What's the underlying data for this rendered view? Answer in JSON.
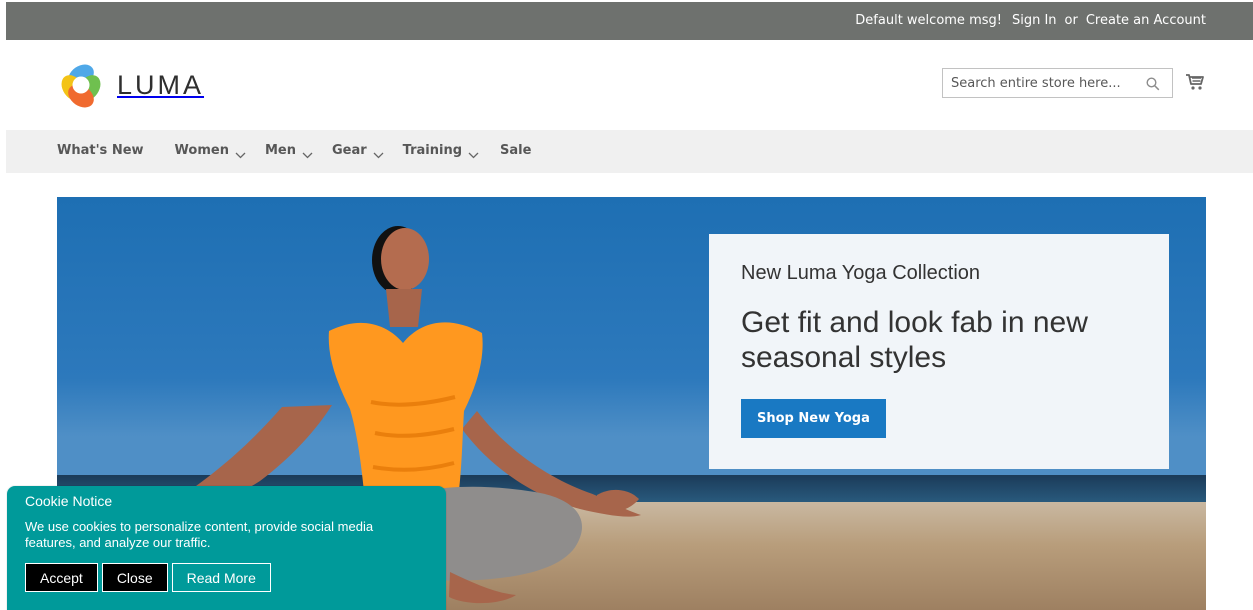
{
  "top_bar": {
    "welcome": "Default welcome msg!",
    "sign_in": "Sign In",
    "separator": "or",
    "create_account": "Create an Account"
  },
  "header": {
    "brand": "LUMA",
    "search_placeholder": "Search entire store here...",
    "search_value": ""
  },
  "nav": {
    "items": [
      {
        "label": "What's New",
        "has_dropdown": false
      },
      {
        "label": "Women",
        "has_dropdown": true
      },
      {
        "label": "Men",
        "has_dropdown": true
      },
      {
        "label": "Gear",
        "has_dropdown": true
      },
      {
        "label": "Training",
        "has_dropdown": true
      },
      {
        "label": "Sale",
        "has_dropdown": false
      }
    ]
  },
  "hero": {
    "kicker": "New Luma Yoga Collection",
    "title": "Get fit and look fab in new seasonal styles",
    "button_label": "Shop New Yoga"
  },
  "cookie_notice": {
    "title": "Cookie Notice",
    "text": "We use cookies to personalize content, provide social media features, and analyze our traffic.",
    "accept_label": "Accept",
    "close_label": "Close",
    "read_more_label": "Read More"
  },
  "colors": {
    "top_bar": "#6e716e",
    "nav": "#f0f0f0",
    "primary": "#1979c3",
    "cookie": "#009a9a",
    "text": "#575757"
  },
  "icons": {
    "logo": "luma-logo-icon",
    "search": "search-icon",
    "cart": "cart-icon",
    "dropdown": "chevron-down-icon"
  }
}
